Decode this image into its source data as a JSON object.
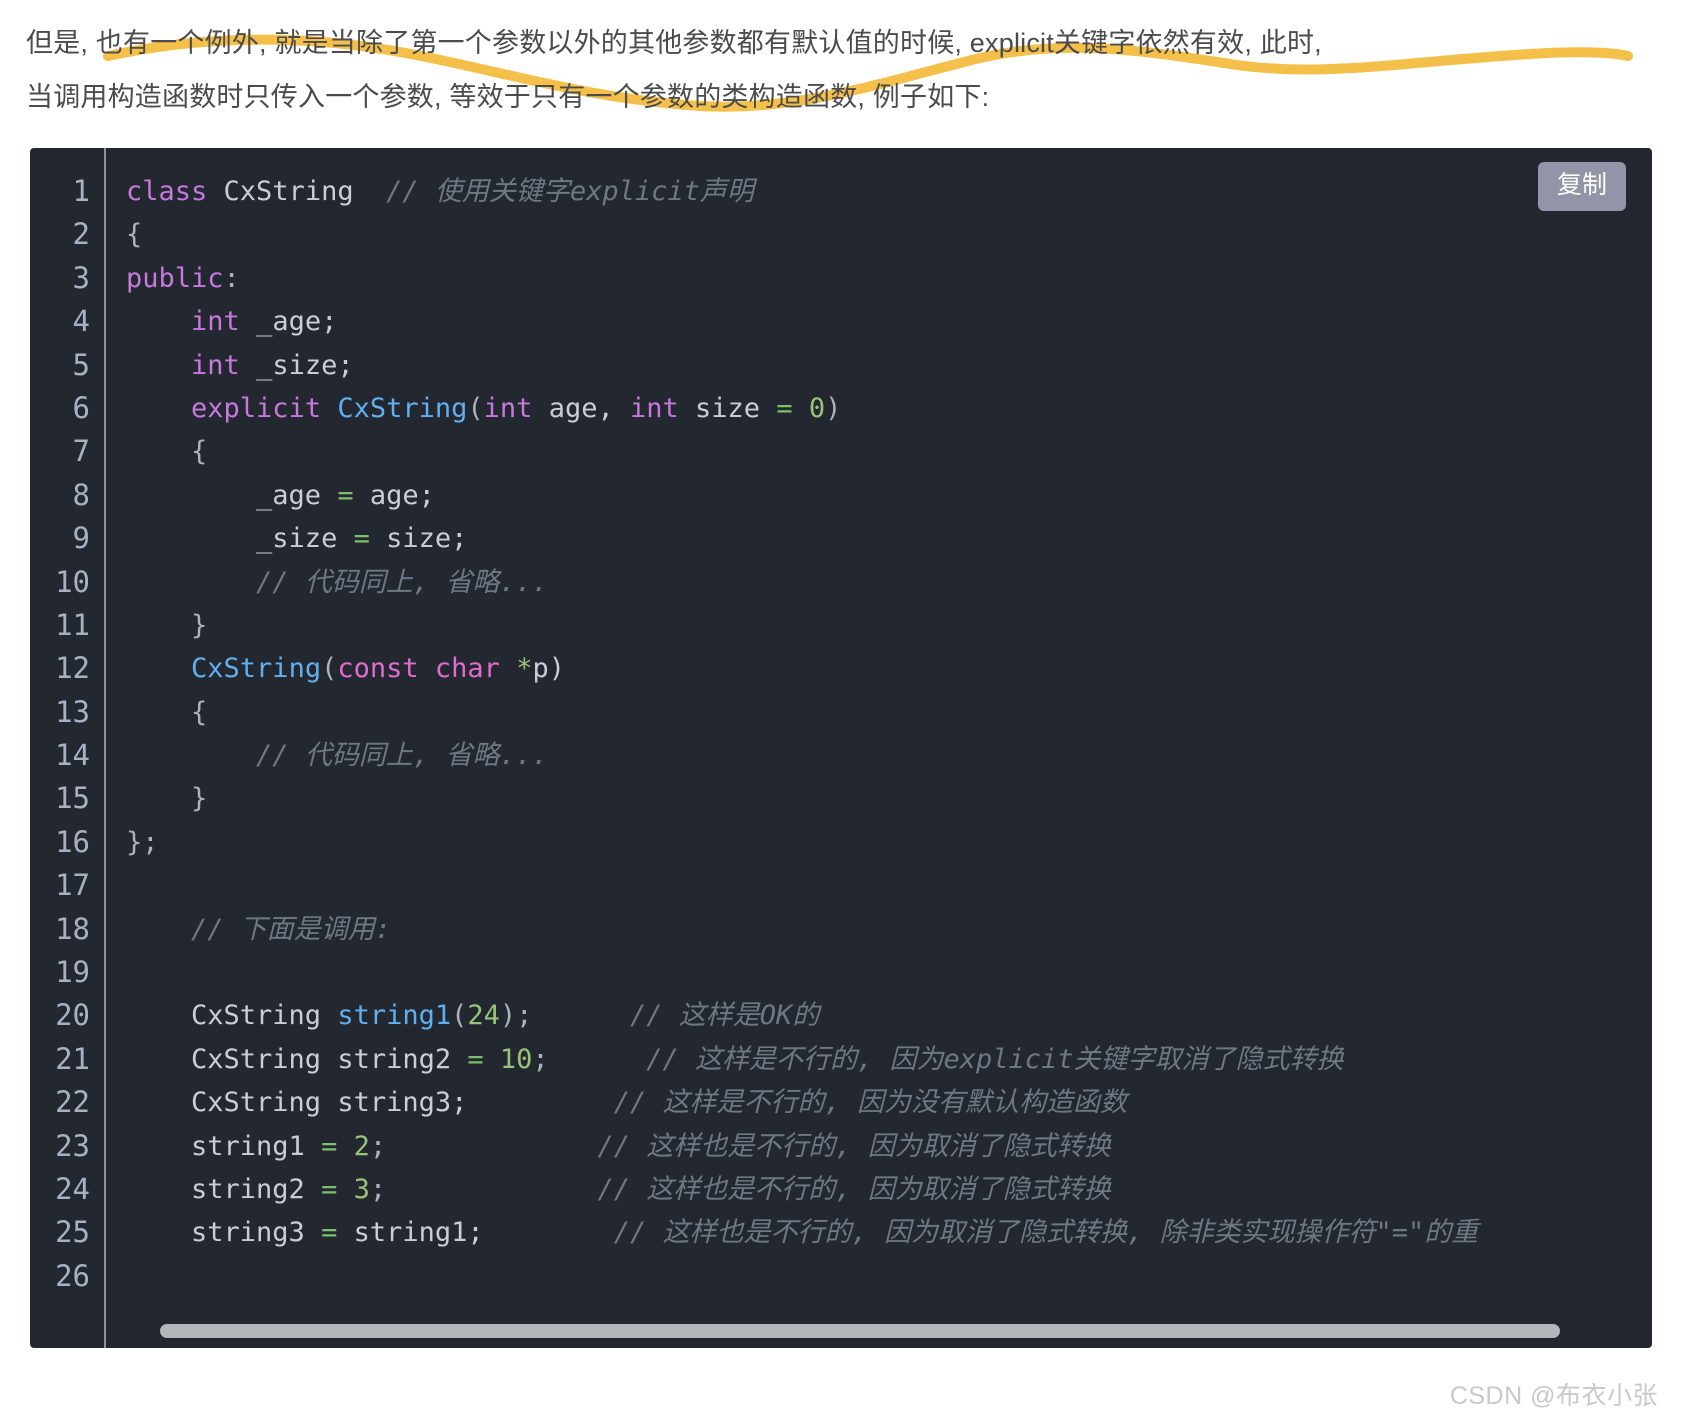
{
  "article": {
    "intro_line_1": "但是, 也有一个例外, 就是当除了第一个参数以外的其他参数都有默认值的时候, explicit关键字依然有效, 此时,",
    "intro_line_2": "当调用构造函数时只传入一个参数, 等效于只有一个参数的类构造函数, 例子如下:",
    "highlight_color": "#f5c04a"
  },
  "code_block": {
    "language": "cpp",
    "background_color": "#232730",
    "copy_button_label": "复制",
    "line_numbers": [
      "1",
      "2",
      "3",
      "4",
      "5",
      "6",
      "7",
      "8",
      "9",
      "10",
      "11",
      "12",
      "13",
      "14",
      "15",
      "16",
      "17",
      "18",
      "19",
      "20",
      "21",
      "22",
      "23",
      "24",
      "25",
      "26"
    ],
    "lines": [
      {
        "n": "1",
        "tokens": [
          {
            "t": "class",
            "c": "kw"
          },
          {
            "t": " ",
            "c": "plain"
          },
          {
            "t": "CxString",
            "c": "plain"
          },
          {
            "t": "  ",
            "c": "plain"
          },
          {
            "t": "// 使用关键字explicit声明",
            "c": "cmt"
          }
        ]
      },
      {
        "n": "2",
        "tokens": [
          {
            "t": "{",
            "c": "punc"
          }
        ]
      },
      {
        "n": "3",
        "tokens": [
          {
            "t": "public",
            "c": "kw"
          },
          {
            "t": ":",
            "c": "punc"
          }
        ]
      },
      {
        "n": "4",
        "tokens": [
          {
            "t": "    ",
            "c": "plain"
          },
          {
            "t": "int",
            "c": "kw"
          },
          {
            "t": " _age;",
            "c": "plain"
          }
        ]
      },
      {
        "n": "5",
        "tokens": [
          {
            "t": "    ",
            "c": "plain"
          },
          {
            "t": "int",
            "c": "kw"
          },
          {
            "t": " _size;",
            "c": "plain"
          }
        ]
      },
      {
        "n": "6",
        "tokens": [
          {
            "t": "    ",
            "c": "plain"
          },
          {
            "t": "explicit",
            "c": "kw"
          },
          {
            "t": " ",
            "c": "plain"
          },
          {
            "t": "CxString",
            "c": "type"
          },
          {
            "t": "(",
            "c": "punc"
          },
          {
            "t": "int",
            "c": "kw"
          },
          {
            "t": " age, ",
            "c": "plain"
          },
          {
            "t": "int",
            "c": "kw"
          },
          {
            "t": " size ",
            "c": "plain"
          },
          {
            "t": "=",
            "c": "eq"
          },
          {
            "t": " ",
            "c": "plain"
          },
          {
            "t": "0",
            "c": "num"
          },
          {
            "t": ")",
            "c": "punc"
          }
        ]
      },
      {
        "n": "7",
        "tokens": [
          {
            "t": "    {",
            "c": "punc"
          }
        ]
      },
      {
        "n": "8",
        "tokens": [
          {
            "t": "        _age ",
            "c": "plain"
          },
          {
            "t": "=",
            "c": "eq"
          },
          {
            "t": " age;",
            "c": "plain"
          }
        ]
      },
      {
        "n": "9",
        "tokens": [
          {
            "t": "        _size ",
            "c": "plain"
          },
          {
            "t": "=",
            "c": "eq"
          },
          {
            "t": " size;",
            "c": "plain"
          }
        ]
      },
      {
        "n": "10",
        "tokens": [
          {
            "t": "        ",
            "c": "plain"
          },
          {
            "t": "// 代码同上, 省略...",
            "c": "cmt"
          }
        ]
      },
      {
        "n": "11",
        "tokens": [
          {
            "t": "    }",
            "c": "punc"
          }
        ]
      },
      {
        "n": "12",
        "tokens": [
          {
            "t": "    ",
            "c": "plain"
          },
          {
            "t": "CxString",
            "c": "type"
          },
          {
            "t": "(",
            "c": "punc"
          },
          {
            "t": "const",
            "c": "kw2"
          },
          {
            "t": " ",
            "c": "plain"
          },
          {
            "t": "char",
            "c": "kw2"
          },
          {
            "t": " ",
            "c": "plain"
          },
          {
            "t": "*",
            "c": "star"
          },
          {
            "t": "p)",
            "c": "plain"
          }
        ]
      },
      {
        "n": "13",
        "tokens": [
          {
            "t": "    {",
            "c": "punc"
          }
        ]
      },
      {
        "n": "14",
        "tokens": [
          {
            "t": "        ",
            "c": "plain"
          },
          {
            "t": "// 代码同上, 省略...",
            "c": "cmt"
          }
        ]
      },
      {
        "n": "15",
        "tokens": [
          {
            "t": "    }",
            "c": "punc"
          }
        ]
      },
      {
        "n": "16",
        "tokens": [
          {
            "t": "};",
            "c": "punc"
          }
        ]
      },
      {
        "n": "17",
        "tokens": [
          {
            "t": "",
            "c": "plain"
          }
        ]
      },
      {
        "n": "18",
        "tokens": [
          {
            "t": "    ",
            "c": "plain"
          },
          {
            "t": "// 下面是调用:",
            "c": "cmt"
          }
        ]
      },
      {
        "n": "19",
        "tokens": [
          {
            "t": "",
            "c": "plain"
          }
        ]
      },
      {
        "n": "20",
        "tokens": [
          {
            "t": "    CxString ",
            "c": "plain"
          },
          {
            "t": "string1",
            "c": "type"
          },
          {
            "t": "(",
            "c": "punc"
          },
          {
            "t": "24",
            "c": "num"
          },
          {
            "t": ");",
            "c": "punc"
          },
          {
            "t": "      ",
            "c": "plain"
          },
          {
            "t": "// 这样是OK的",
            "c": "cmt"
          }
        ]
      },
      {
        "n": "21",
        "tokens": [
          {
            "t": "    CxString string2 ",
            "c": "plain"
          },
          {
            "t": "=",
            "c": "eq"
          },
          {
            "t": " ",
            "c": "plain"
          },
          {
            "t": "10",
            "c": "num"
          },
          {
            "t": ";",
            "c": "punc"
          },
          {
            "t": "      ",
            "c": "plain"
          },
          {
            "t": "// 这样是不行的, 因为explicit关键字取消了隐式转换",
            "c": "cmt"
          }
        ]
      },
      {
        "n": "22",
        "tokens": [
          {
            "t": "    CxString string3;",
            "c": "plain"
          },
          {
            "t": "         ",
            "c": "plain"
          },
          {
            "t": "// 这样是不行的, 因为没有默认构造函数",
            "c": "cmt"
          }
        ]
      },
      {
        "n": "23",
        "tokens": [
          {
            "t": "    string1 ",
            "c": "plain"
          },
          {
            "t": "=",
            "c": "eq"
          },
          {
            "t": " ",
            "c": "plain"
          },
          {
            "t": "2",
            "c": "num"
          },
          {
            "t": ";",
            "c": "punc"
          },
          {
            "t": "             ",
            "c": "plain"
          },
          {
            "t": "// 这样也是不行的, 因为取消了隐式转换",
            "c": "cmt"
          }
        ]
      },
      {
        "n": "24",
        "tokens": [
          {
            "t": "    string2 ",
            "c": "plain"
          },
          {
            "t": "=",
            "c": "eq"
          },
          {
            "t": " ",
            "c": "plain"
          },
          {
            "t": "3",
            "c": "num"
          },
          {
            "t": ";",
            "c": "punc"
          },
          {
            "t": "             ",
            "c": "plain"
          },
          {
            "t": "// 这样也是不行的, 因为取消了隐式转换",
            "c": "cmt"
          }
        ]
      },
      {
        "n": "25",
        "tokens": [
          {
            "t": "    string3 ",
            "c": "plain"
          },
          {
            "t": "=",
            "c": "eq"
          },
          {
            "t": " string1;",
            "c": "plain"
          },
          {
            "t": "        ",
            "c": "plain"
          },
          {
            "t": "// 这样也是不行的, 因为取消了隐式转换, 除非类实现操作符\"=\"的重",
            "c": "cmt"
          }
        ]
      },
      {
        "n": "26",
        "tokens": [
          {
            "t": "",
            "c": "plain"
          }
        ]
      }
    ]
  },
  "footer": {
    "watermark": "CSDN @布衣小张"
  }
}
